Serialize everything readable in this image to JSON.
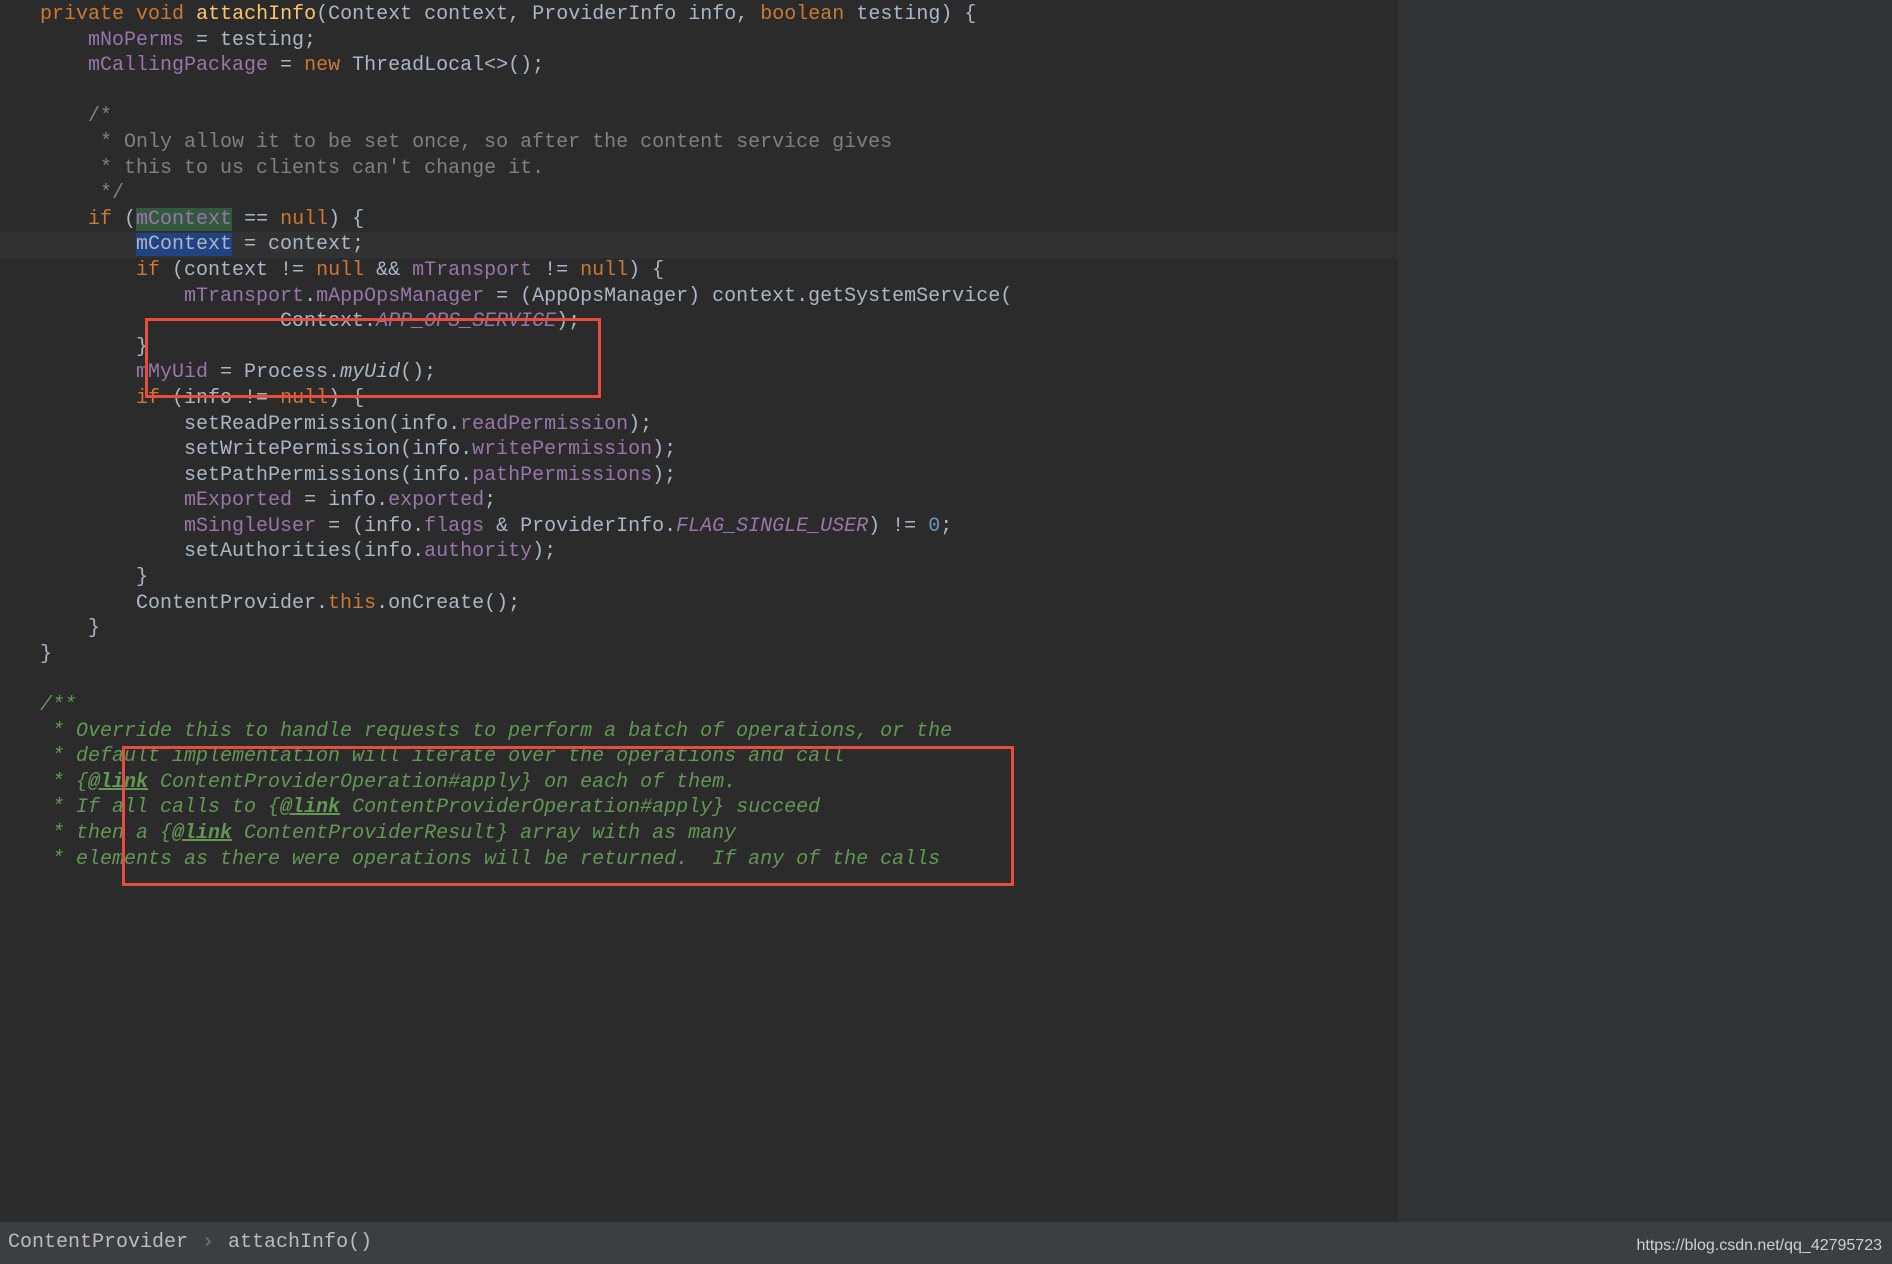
{
  "colors": {
    "accent_box": "#e74c3c"
  },
  "breadcrumb": {
    "class": "ContentProvider",
    "method": "attachInfo()"
  },
  "watermark": "https://blog.csdn.net/qq_42795723",
  "code": {
    "l1": {
      "kw1": "private",
      "kw2": "void",
      "method": "attachInfo",
      "p1t": "Context",
      "p1n": "context",
      "c1": ",",
      "p2t": "ProviderInfo",
      "p2n": "info",
      "c2": ",",
      "p3t": "boolean",
      "p3n": "testing",
      "close": ") {"
    },
    "l2": {
      "field": "mNoPerms",
      "rest": " = testing;"
    },
    "l3": {
      "field": "mCallingPackage",
      "eq": " = ",
      "kw": "new",
      "rest": " ThreadLocal<>();"
    },
    "l5": "/*",
    "l6": " * Only allow it to be set once, so after the content service gives",
    "l7": " * this to us clients can't change it.",
    "l8": " */",
    "l9": {
      "kw": "if",
      "open": " (",
      "occ": "mContext",
      "eq": " == ",
      "null": "null",
      "close": ") {"
    },
    "l10": {
      "sel": "mContext",
      "rest": " = context;"
    },
    "l11": {
      "kw": "if",
      "open": " (context != ",
      "null1": "null",
      "and": " && ",
      "field": "mTransport",
      "ne": " != ",
      "null2": "null",
      "close": ") {"
    },
    "l12": {
      "f1": "mTransport",
      "d": ".",
      "f2": "mAppOpsManager",
      "rest": " = (AppOpsManager) context.getSystemService("
    },
    "l13": {
      "pre": "Context.",
      "const": "APP_OPS_SERVICE",
      "close": ");"
    },
    "l14": "}",
    "l15": {
      "f": "mMyUid",
      "eq": " = Process.",
      "m": "myUid",
      "close": "();"
    },
    "l16": {
      "kw": "if",
      "open": " (info != ",
      "n": "null",
      "close": ") {"
    },
    "l17": {
      "m": "setReadPermission(info.",
      "f": "readPermission",
      "c": ");"
    },
    "l18": {
      "m": "setWritePermission(info.",
      "f": "writePermission",
      "c": ");"
    },
    "l19": {
      "m": "setPathPermissions(info.",
      "f": "pathPermissions",
      "c": ");"
    },
    "l20": {
      "f": "mExported",
      "eq": " = info.",
      "f2": "exported",
      "c": ";"
    },
    "l21": {
      "f": "mSingleUser",
      "eq": " = (info.",
      "f2": "flags",
      "and": " & ProviderInfo.",
      "const": "FLAG_SINGLE_USER",
      "close": ") != ",
      "num": "0",
      "semi": ";"
    },
    "l22": {
      "m": "setAuthorities(info.",
      "f": "authority",
      "c": ");"
    },
    "l23": "}",
    "l24": {
      "pre": "ContentProvider.",
      "kw": "this",
      "rest": ".onCreate();"
    },
    "l25": "}",
    "l26": "}",
    "d1": "/**",
    "d2": " * Override this to handle requests to perform a batch of operations, or the",
    "d3": " * default implementation will iterate over the operations and call",
    "d4a": " * {",
    "d4link": "@link",
    "d4b": " ContentProviderOperation#apply} on each of them.",
    "d5a": " * If all calls to {",
    "d5link": "@link",
    "d5b": " ContentProviderOperation#apply} succeed",
    "d6a": " * then a {",
    "d6link": "@link",
    "d6b": " ContentProviderResult} array with as many",
    "d7": " * elements as there were operations will be returned.  If any of the calls"
  }
}
